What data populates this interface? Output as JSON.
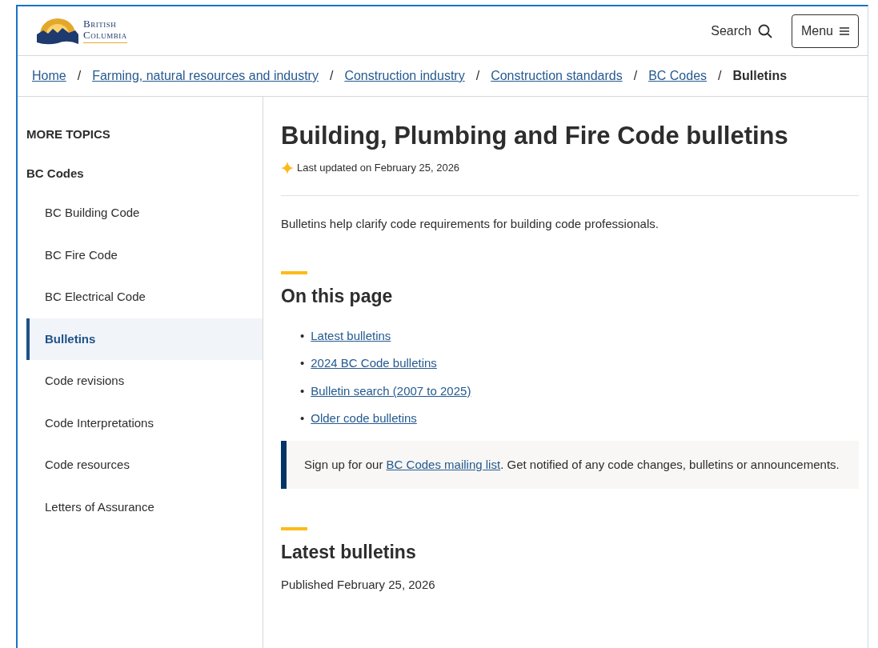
{
  "header": {
    "logo_lines": [
      "British",
      "Columbia"
    ],
    "search_label": "Search",
    "menu_label": "Menu"
  },
  "breadcrumb_separator": "/",
  "breadcrumb": [
    {
      "label": "Home",
      "current": false
    },
    {
      "label": "Farming, natural resources and industry",
      "current": false
    },
    {
      "label": "Construction industry",
      "current": false
    },
    {
      "label": "Construction standards",
      "current": false
    },
    {
      "label": "BC Codes",
      "current": false
    },
    {
      "label": "Bulletins",
      "current": true
    }
  ],
  "sidebar": {
    "heading": "MORE TOPICS",
    "section": "BC Codes",
    "items": [
      {
        "label": "BC Building Code",
        "selected": false
      },
      {
        "label": "BC Fire Code",
        "selected": false
      },
      {
        "label": "BC Electrical Code",
        "selected": false
      },
      {
        "label": "Bulletins",
        "selected": true
      },
      {
        "label": "Code revisions",
        "selected": false
      },
      {
        "label": "Code Interpretations",
        "selected": false
      },
      {
        "label": "Code resources",
        "selected": false
      },
      {
        "label": "Letters of Assurance",
        "selected": false
      }
    ]
  },
  "main": {
    "title": "Building, Plumbing and Fire Code bulletins",
    "updated": "Last updated on February 25, 2026",
    "intro": "Bulletins help clarify code requirements for building code professionals.",
    "toc_heading": "On this page",
    "toc": [
      {
        "bullet": "•",
        "label": "Latest bulletins"
      },
      {
        "bullet": "•",
        "label": "2024 BC Code bulletins"
      },
      {
        "bullet": "•",
        "label": "Bulletin search (2007 to 2025)"
      },
      {
        "bullet": "•",
        "label": "Older code bulletins"
      }
    ],
    "callout": {
      "before": "Sign up for our ",
      "link": "BC Codes mailing list",
      "after": ". Get notified of any code changes, bulletins or announcements."
    },
    "section_heading": "Latest bulletins",
    "published": "Published February 25, 2026"
  }
}
